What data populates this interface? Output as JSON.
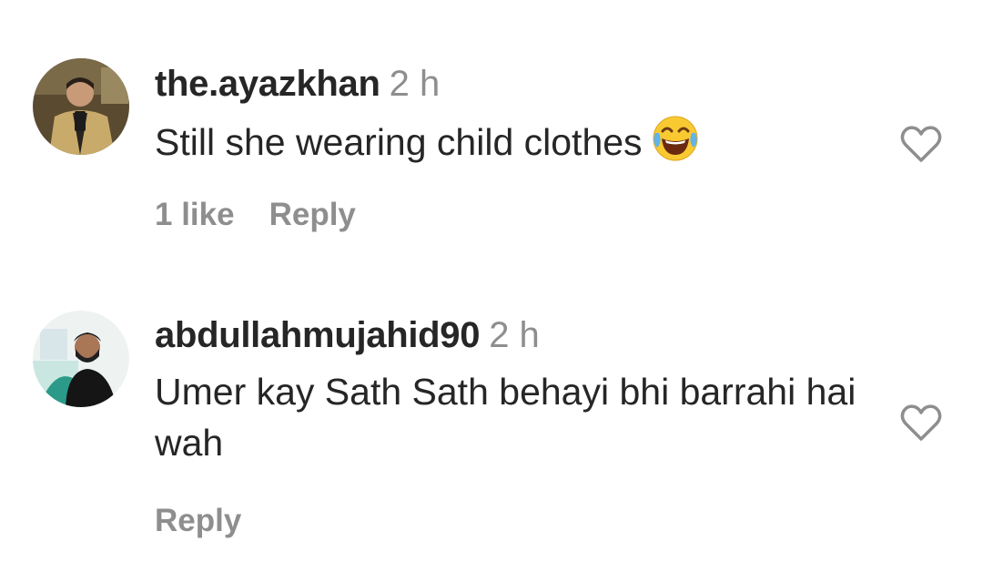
{
  "comments": [
    {
      "username": "the.ayazkhan",
      "time": "2 h",
      "text": "Still she wearing child clothes",
      "emoji": "face-with-tears-of-joy",
      "likes": "1 like",
      "reply": "Reply"
    },
    {
      "username": "abdullahmujahid90",
      "time": "2 h",
      "text": "Umer kay Sath Sath behayi bhi barrahi hai wah",
      "reply": "Reply"
    }
  ],
  "colors": {
    "text": "#262626",
    "muted": "#8e8e8e",
    "heart_outline": "#8e8e8e"
  }
}
